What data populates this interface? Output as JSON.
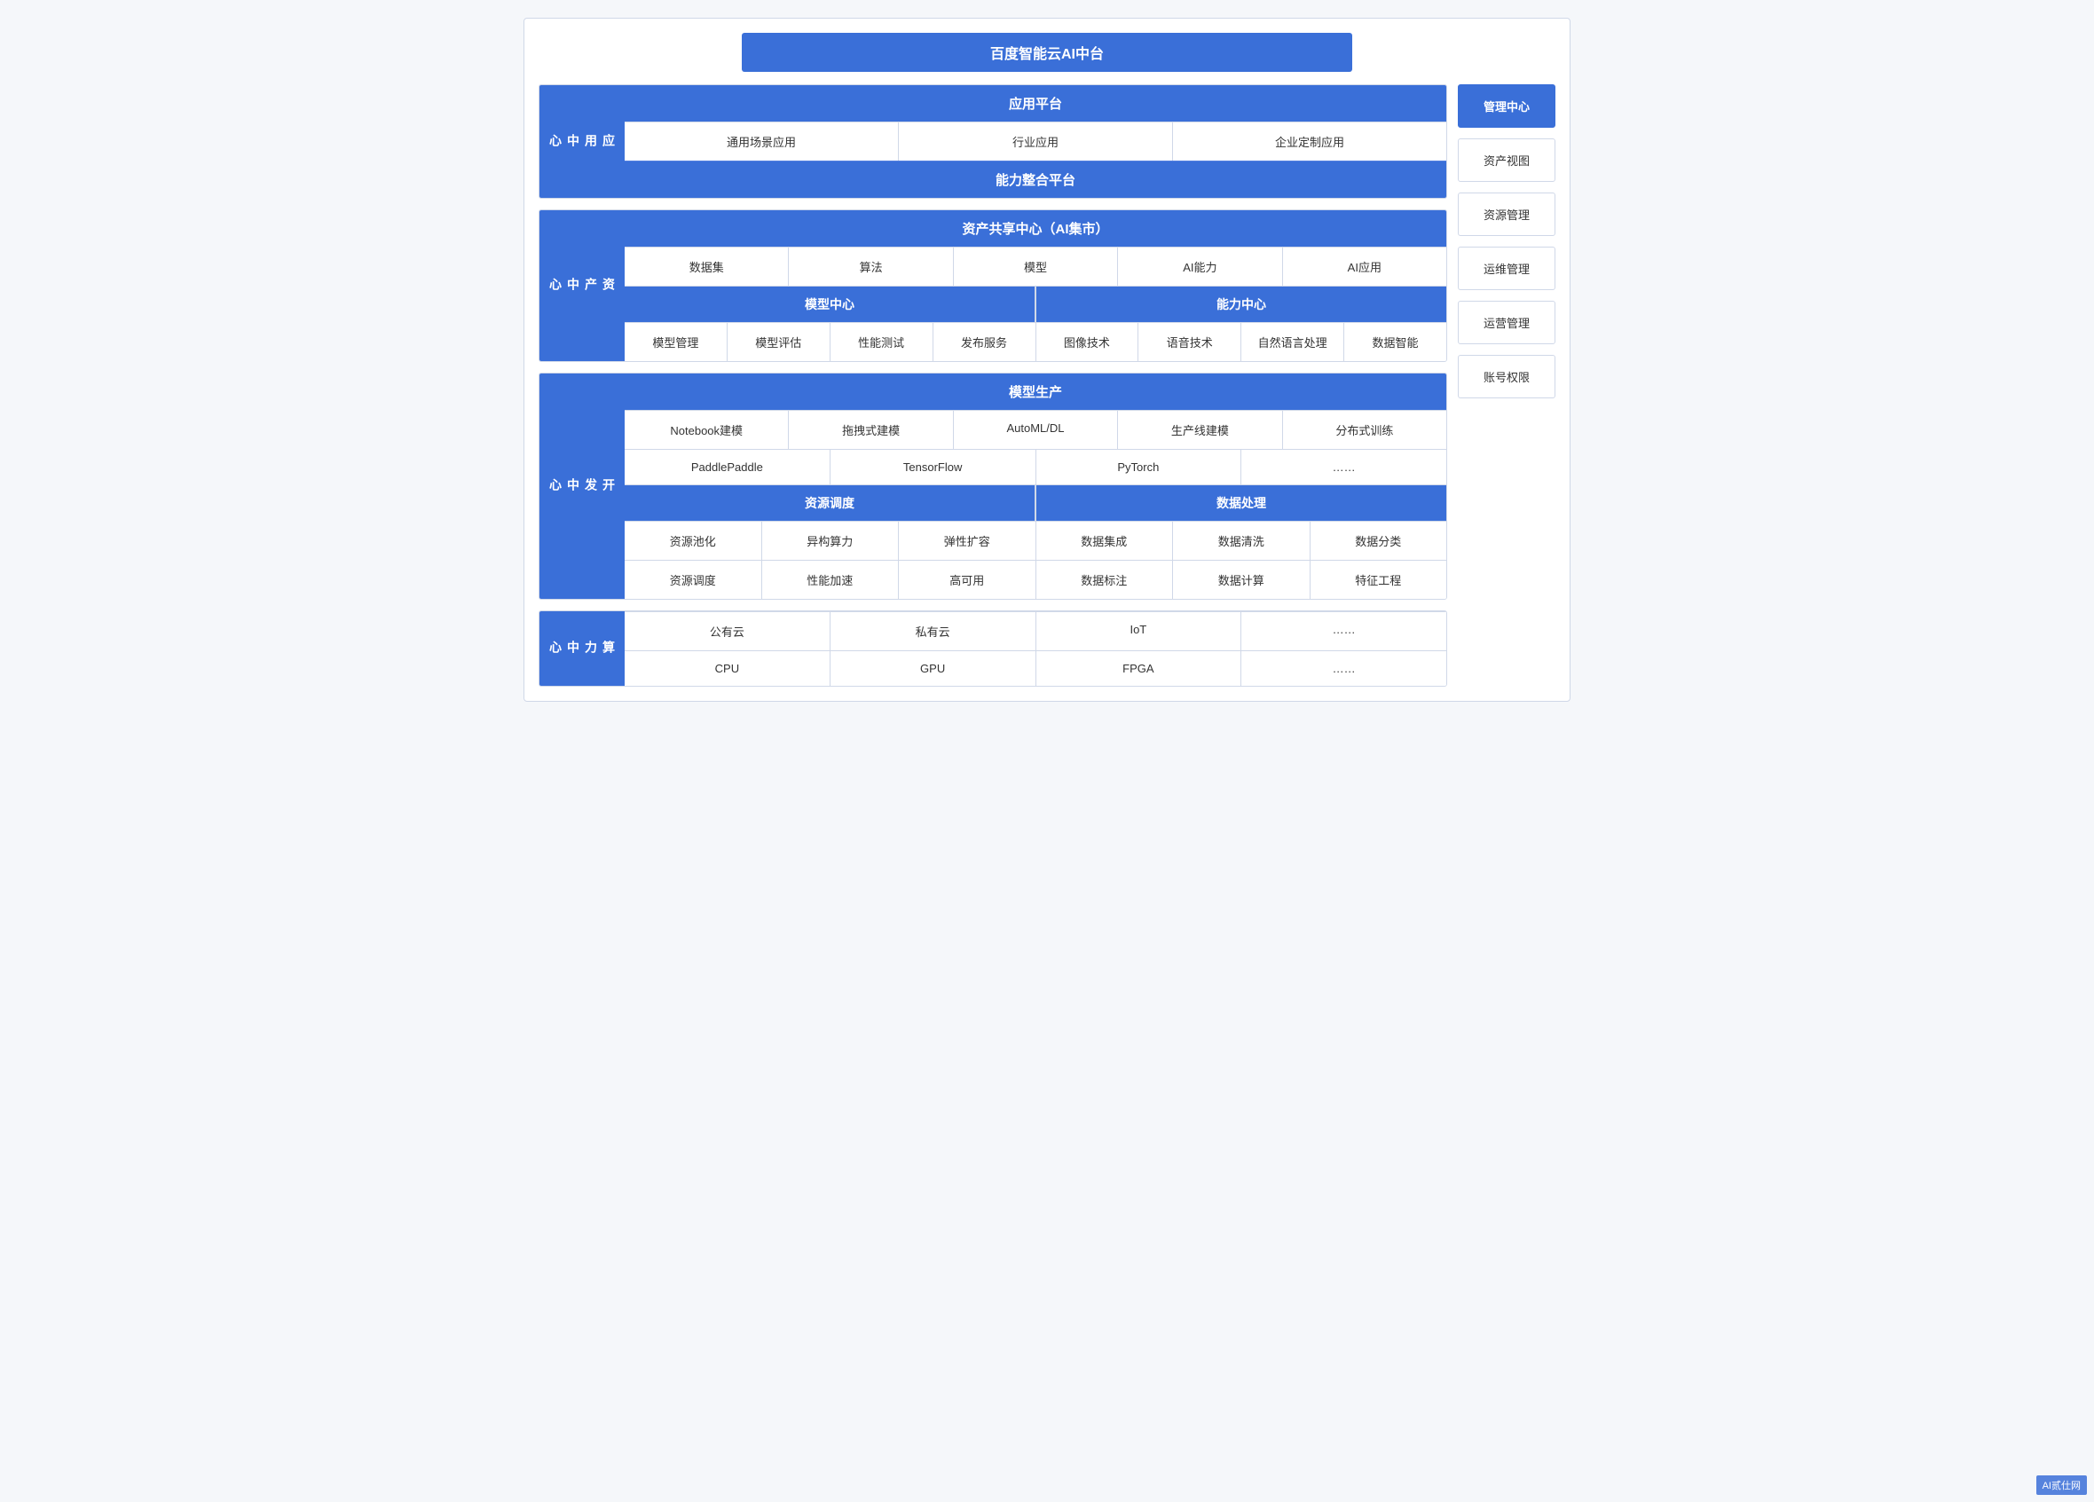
{
  "title": "百度智能云AI中台",
  "sections": {
    "yingyong": {
      "label": "应\n用\n中\n心",
      "platform": "应用平台",
      "row1": [
        "通用场景应用",
        "行业应用",
        "企业定制应用"
      ],
      "integration": "能力整合平台"
    },
    "zichan": {
      "label": "资\n产\n中\n心",
      "sharing": "资产共享中心（AI集市）",
      "row1": [
        "数据集",
        "算法",
        "模型",
        "AI能力",
        "AI应用"
      ],
      "model_center": "模型中心",
      "ability_center": "能力中心",
      "model_sub": [
        "模型管理",
        "模型评估",
        "性能测试",
        "发布服务"
      ],
      "ability_sub": [
        "图像技术",
        "语音技术",
        "自然语言处理",
        "数据智能"
      ]
    },
    "kaifa": {
      "label": "开\n发\n中\n心",
      "model_prod": "模型生产",
      "row1": [
        "Notebook建模",
        "拖拽式建模",
        "AutoML/DL",
        "生产线建模",
        "分布式训练"
      ],
      "frameworks": [
        "PaddlePaddle",
        "TensorFlow",
        "PyTorch",
        "……"
      ],
      "resource_dispatch": "资源调度",
      "data_processing": "数据处理",
      "res_sub": [
        "资源池化",
        "异构算力",
        "弹性扩容"
      ],
      "data_sub": [
        "数据集成",
        "数据清洗",
        "数据分类"
      ],
      "res_sub2": [
        "资源调度",
        "性能加速",
        "高可用"
      ],
      "data_sub2": [
        "数据标注",
        "数据计算",
        "特征工程"
      ]
    },
    "suanli": {
      "label": "算\n力\n中\n心",
      "row1": [
        "公有云",
        "私有云",
        "IoT",
        "……"
      ],
      "row2": [
        "CPU",
        "GPU",
        "FPGA",
        "……"
      ]
    }
  },
  "right_sidebar": {
    "top": "管理中心",
    "items": [
      "资产视图",
      "资源管理",
      "运维管理",
      "运营管理",
      "账号权限"
    ]
  },
  "watermark": "AI贰仕网"
}
